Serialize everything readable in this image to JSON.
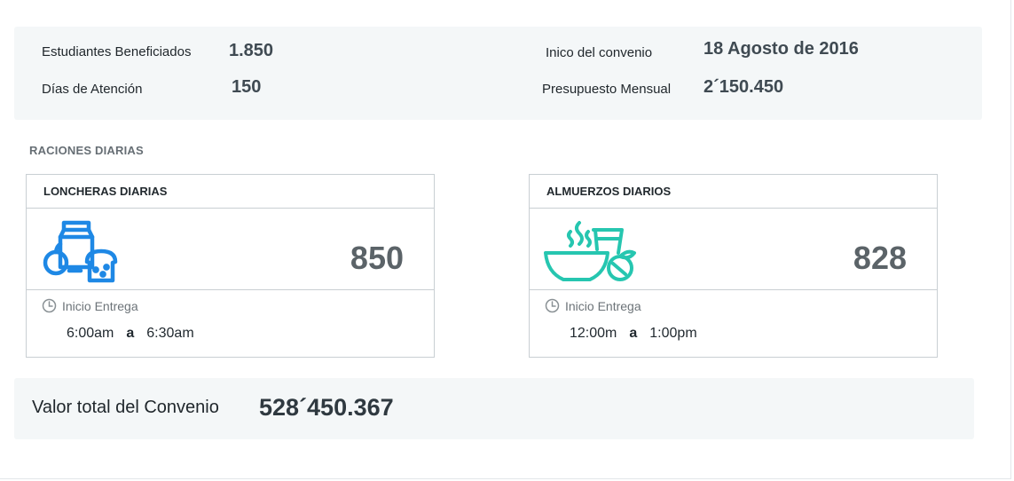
{
  "summary": {
    "students_label": "Estudiantes Beneficiados",
    "students_value": "1.850",
    "days_label": "Días de Atención",
    "days_value": "150",
    "start_label": "Inico del convenio",
    "start_value": "18 Agosto de 2016",
    "budget_label": "Presupuesto Mensual",
    "budget_value": "2´150.450"
  },
  "section_title": "RACIONES DIARIAS",
  "cards": [
    {
      "title": "LONCHERAS DIARIAS",
      "icon": "lunchbox-icon",
      "icon_color": "#1e88e5",
      "count": "850",
      "delivery_label": "Inicio Entrega",
      "time_start": "6:00am",
      "time_sep": "a",
      "time_end": "6:30am"
    },
    {
      "title": "ALMUERZOS DIARIOS",
      "icon": "lunch-bowl-icon",
      "icon_color": "#26c6b0",
      "count": "828",
      "delivery_label": "Inicio Entrega",
      "time_start": "12:00m",
      "time_sep": "a",
      "time_end": "1:00pm"
    }
  ],
  "total": {
    "label": "Valor total del Convenio",
    "value": "528´450.367"
  }
}
